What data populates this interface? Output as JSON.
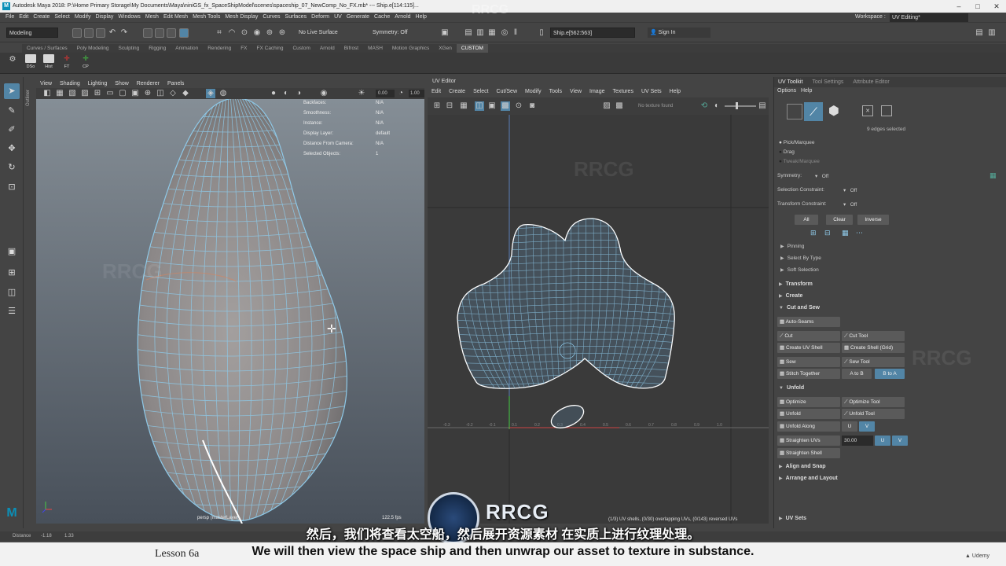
{
  "window": {
    "title": "Autodesk Maya 2018: P:\\Home Primary Storage\\My Documents\\Maya\\niniGS_fx_SpaceShipModel\\scenes\\spaceship_07_NewComp_No_FX.mb*  ---  Ship.e[114:115]..."
  },
  "menu": {
    "items": [
      "File",
      "Edit",
      "Create",
      "Select",
      "Modify",
      "Display",
      "Windows",
      "Mesh",
      "Edit Mesh",
      "Mesh Tools",
      "Mesh Display",
      "Curves",
      "Surfaces",
      "Deform",
      "UV",
      "Generate",
      "Cache",
      "Arnold",
      "Help"
    ],
    "workspace_label": "Workspace :",
    "workspace_value": "UV Editing*"
  },
  "status": {
    "mode": "Modeling",
    "live_surface": "No Live Surface",
    "symmetry": "Symmetry: Off",
    "selection_field": "Ship.e[562:563]",
    "sign_in": "Sign In"
  },
  "shelf": {
    "tabs": [
      "Curves / Surfaces",
      "Poly Modeling",
      "Sculpting",
      "Rigging",
      "Animation",
      "Rendering",
      "FX",
      "FX Caching",
      "Custom",
      "Arnold",
      "Bifrost",
      "MASH",
      "Motion Graphics",
      "XGen",
      "CUSTOM"
    ],
    "active_tab": "CUSTOM",
    "buttons": [
      "DSo",
      "Hist",
      "FT",
      "CP"
    ]
  },
  "viewport": {
    "menu": [
      "View",
      "Shading",
      "Lighting",
      "Show",
      "Renderer",
      "Panels"
    ],
    "field_a": "0.00",
    "field_b": "1.00",
    "hud": [
      {
        "k": "Backfaces:",
        "v": "N/A"
      },
      {
        "k": "Smoothness:",
        "v": "N/A"
      },
      {
        "k": "Instance:",
        "v": "N/A"
      },
      {
        "k": "Display Layer:",
        "v": "default"
      },
      {
        "k": "Distance From Camera:",
        "v": "N/A"
      },
      {
        "k": "Selected Objects:",
        "v": "1"
      }
    ],
    "camera": "persp (masterLayer)",
    "fps": "122.5 fps",
    "side_label": "Outliner"
  },
  "uv_editor": {
    "title": "UV Editor",
    "menu": [
      "Edit",
      "Create",
      "Select",
      "Cut/Sew",
      "Modify",
      "Tools",
      "View",
      "Image",
      "Textures",
      "UV Sets",
      "Help"
    ],
    "texture": "No texture found",
    "axis_labels": [
      "-0.3",
      "-0.2",
      "-0.1",
      "0.1",
      "0.2",
      "0.3",
      "0.4",
      "0.5",
      "0.6",
      "0.7",
      "0.8",
      "0.9",
      "1.0"
    ],
    "status": "(1/3) UV shells, (0/30) overlapping UVs, (0/143) reversed UVs"
  },
  "uv_toolkit": {
    "tabs": [
      "UV Toolkit",
      "Tool Settings",
      "Attribute Editor"
    ],
    "menu": [
      "Options",
      "Help"
    ],
    "selection_info": "9 edges selected",
    "modes": [
      "Pick/Marquee",
      "Drag",
      "Tweak/Marquee"
    ],
    "symmetry_label": "Symmetry:",
    "symmetry_value": "Off",
    "selection_constraint_label": "Selection Constraint:",
    "selection_constraint_value": "Off",
    "transform_constraint_label": "Transform Constraint:",
    "transform_constraint_value": "Off",
    "buttons_sel": [
      "All",
      "Clear",
      "Inverse"
    ],
    "subsections": [
      "Pinning",
      "Select By Type",
      "Soft Selection"
    ],
    "sections": {
      "transform": "Transform",
      "create": "Create",
      "cut_sew": "Cut and Sew",
      "unfold": "Unfold",
      "align": "Align and Snap",
      "arrange": "Arrange and Layout",
      "uvsets": "UV Sets"
    },
    "auto_seams": "Auto-Seams",
    "cut": "Cut",
    "cut_tool": "Cut Tool",
    "create_shell": "Create UV Shell",
    "create_shell_grid": "Create Shell (Grid)",
    "sew": "Sew",
    "sew_tool": "Sew Tool",
    "stitch": "Stitch Together",
    "a_to_b": "A to B",
    "b_to_a": "B to A",
    "optimize": "Optimize",
    "optimize_tool": "Optimize Tool",
    "unfold": "Unfold",
    "unfold_tool": "Unfold Tool",
    "unfold_along": "Unfold Along",
    "u": "U",
    "v": "V",
    "straighten_uvs": "Straighten UVs",
    "straighten_value": "30.00",
    "straighten_shell": "Straighten Shell"
  },
  "bottom": {
    "distance_label": "Distance",
    "distance_values": [
      "-1.18",
      "1.33"
    ]
  },
  "subtitles": {
    "lesson": "Lesson 6a",
    "cn": "然后，我们将查看太空船，然后展开资源素材 在实质上进行纹理处理。",
    "en": "We will then view the space ship and then unwrap our asset to texture in substance.",
    "brand": "Udemy",
    "watermark": "RRCG"
  },
  "colors": {
    "uv_wire": "#8ec9e8",
    "selection": "#ffffff",
    "accent_blue": "#5285a6",
    "viewport_top": "#858e96"
  }
}
